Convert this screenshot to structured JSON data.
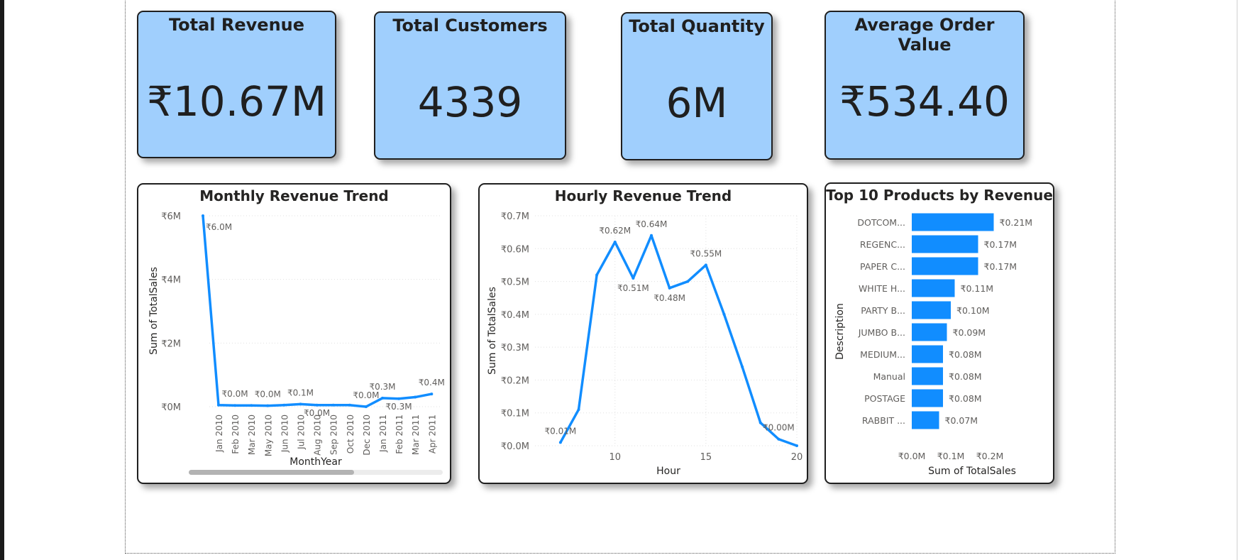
{
  "kpis": [
    {
      "title": "Total Revenue",
      "value": "₹10.67M"
    },
    {
      "title": "Total Customers",
      "value": "4339"
    },
    {
      "title": "Total Quantity",
      "value": "6M"
    },
    {
      "title": "Average Order Value",
      "value": "₹534.40"
    }
  ],
  "colors": {
    "kpi_fill": "#a0cffd",
    "series": "#118dff",
    "text": "#252423",
    "gridline": "#e0e0e0",
    "scrollbar": "#b3b3b3"
  },
  "chart_data": [
    {
      "type": "line",
      "title": "Monthly Revenue Trend",
      "xlabel": "MonthYear",
      "ylabel": "Sum of TotalSales",
      "categories": [
        "Jan 2010",
        "Feb 2010",
        "Mar 2010",
        "May 2010",
        "Jun 2010",
        "Jul 2010",
        "Aug 2010",
        "Sep 2010",
        "Oct 2010",
        "Dec 2010",
        "Jan 2011",
        "Feb 2011",
        "Mar 2011",
        "Apr 2011"
      ],
      "leading_point": {
        "value": 6.0,
        "label": "₹6.0M"
      },
      "values": [
        0.05,
        0.04,
        0.04,
        0.03,
        0.05,
        0.08,
        0.05,
        0.05,
        0.05,
        0.0,
        0.27,
        0.25,
        0.3,
        0.4
      ],
      "data_labels": [
        "",
        "₹0.0M",
        "",
        "₹0.0M",
        "",
        "₹0.1M",
        "₹0.0M",
        "",
        "",
        "₹0.0M",
        "₹0.3M",
        "₹0.3M",
        "",
        "₹0.4M"
      ],
      "ylim": [
        0,
        6
      ],
      "yticks": [
        0,
        2,
        4,
        6
      ],
      "ytick_labels": [
        "₹0M",
        "₹2M",
        "₹4M",
        "₹6M"
      ],
      "grid": true,
      "scrollbar": true
    },
    {
      "type": "line",
      "title": "Hourly Revenue Trend",
      "xlabel": "Hour",
      "ylabel": "Sum of TotalSales",
      "x": [
        7,
        8,
        9,
        10,
        11,
        12,
        13,
        14,
        15,
        16,
        17,
        18,
        19,
        20
      ],
      "values": [
        0.01,
        0.11,
        0.52,
        0.62,
        0.51,
        0.64,
        0.48,
        0.5,
        0.55,
        0.4,
        0.24,
        0.07,
        0.02,
        0.0
      ],
      "data_labels": [
        "₹0.01M",
        "",
        "",
        "₹0.62M",
        "₹0.51M",
        "₹0.64M",
        "₹0.48M",
        "",
        "₹0.55M",
        "",
        "",
        "",
        "₹0.00M",
        ""
      ],
      "xlim": [
        5.6,
        20
      ],
      "xticks": [
        10,
        15,
        20
      ],
      "xtick_labels": [
        "10",
        "15",
        "20"
      ],
      "ylim": [
        0,
        0.7
      ],
      "yticks": [
        0,
        0.1,
        0.2,
        0.3,
        0.4,
        0.5,
        0.6,
        0.7
      ],
      "ytick_labels": [
        "₹0.0M",
        "₹0.1M",
        "₹0.2M",
        "₹0.3M",
        "₹0.4M",
        "₹0.5M",
        "₹0.6M",
        "₹0.7M"
      ],
      "grid": true
    },
    {
      "type": "bar",
      "orientation": "horizontal",
      "title": "Top 10 Products by Revenue",
      "xlabel": "Sum of TotalSales",
      "ylabel": "Description",
      "categories": [
        "DOTCOM...",
        "REGENC...",
        "PAPER C...",
        "WHITE H...",
        "PARTY B...",
        "JUMBO B...",
        "MEDIUM...",
        "Manual",
        "POSTAGE",
        "RABBIT ..."
      ],
      "values": [
        0.21,
        0.17,
        0.17,
        0.11,
        0.1,
        0.09,
        0.08,
        0.08,
        0.08,
        0.07
      ],
      "data_labels": [
        "₹0.21M",
        "₹0.17M",
        "₹0.17M",
        "₹0.11M",
        "₹0.10M",
        "₹0.09M",
        "₹0.08M",
        "₹0.08M",
        "₹0.08M",
        "₹0.07M"
      ],
      "xlim": [
        0,
        0.22
      ],
      "xticks": [
        0,
        0.1,
        0.2
      ],
      "xtick_labels": [
        "₹0.0M",
        "₹0.1M",
        "₹0.2M"
      ],
      "grid": false
    }
  ]
}
